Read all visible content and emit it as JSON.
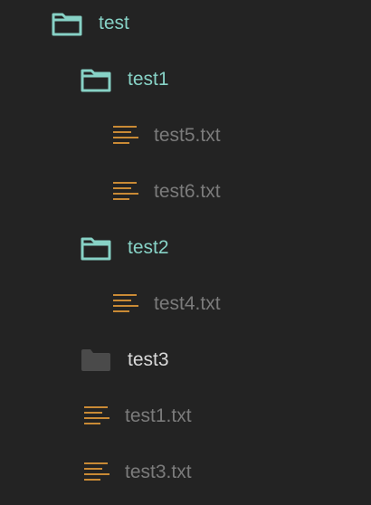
{
  "colors": {
    "background": "#232323",
    "folder_open": "#87d2c6",
    "folder_closed": "#4a4a4a",
    "file_icon": "#c98a35",
    "file_text": "#7b7b7b",
    "folder_closed_text": "#d9d9d9"
  },
  "tree": [
    {
      "name": "test",
      "type": "folder",
      "state": "open",
      "depth": 0,
      "icon": "folder-open-icon"
    },
    {
      "name": "test1",
      "type": "folder",
      "state": "open",
      "depth": 1,
      "icon": "folder-open-icon"
    },
    {
      "name": "test5.txt",
      "type": "file",
      "depth": 2,
      "icon": "text-file-icon"
    },
    {
      "name": "test6.txt",
      "type": "file",
      "depth": 2,
      "icon": "text-file-icon"
    },
    {
      "name": "test2",
      "type": "folder",
      "state": "open",
      "depth": 1,
      "icon": "folder-open-icon"
    },
    {
      "name": "test4.txt",
      "type": "file",
      "depth": 2,
      "icon": "text-file-icon"
    },
    {
      "name": "test3",
      "type": "folder",
      "state": "closed",
      "depth": 1,
      "icon": "folder-closed-icon"
    },
    {
      "name": "test1.txt",
      "type": "file",
      "depth": 1,
      "icon": "text-file-icon"
    },
    {
      "name": "test3.txt",
      "type": "file",
      "depth": 1,
      "icon": "text-file-icon"
    }
  ]
}
